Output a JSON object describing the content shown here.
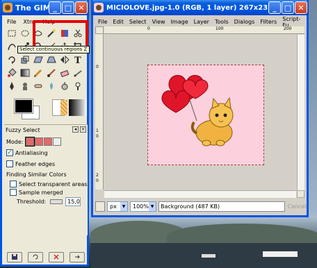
{
  "toolbox": {
    "title": "The GIMP",
    "menu": [
      "File",
      "Xtns",
      "Help"
    ],
    "tooltip": "Select continuous regions   Z",
    "tools": [
      "rect-select-icon",
      "ellipse-select-icon",
      "free-select-icon",
      "fuzzy-select-icon",
      "color-select-icon",
      "scissors-icon",
      "paths-icon",
      "color-picker-icon",
      "zoom-icon",
      "measure-icon",
      "move-icon",
      "crop-icon",
      "rotate-icon",
      "scale-icon",
      "shear-icon",
      "perspective-icon",
      "flip-icon",
      "text-icon",
      "bucket-fill-icon",
      "blend-icon",
      "pencil-icon",
      "paintbrush-icon",
      "eraser-icon",
      "airbrush-icon",
      "ink-icon",
      "clone-icon",
      "heal-icon",
      "convolve-icon",
      "smudge-icon",
      "dodge-icon"
    ],
    "options": {
      "title": "Fuzzy Select",
      "mode_label": "Mode:",
      "antialiasing": "Antialiasing",
      "feather_edges": "Feather edges",
      "finding_similar": "Finding Similar Colors",
      "select_transparent": "Select transparent areas",
      "sample_merged": "Sample merged",
      "threshold_label": "Threshold:",
      "threshold_value": "15,0"
    }
  },
  "image_window": {
    "title": "MICIOLOVE.jpg-1.0 (RGB, 1 layer) 267x231",
    "menu": [
      "File",
      "Edit",
      "Select",
      "View",
      "Image",
      "Layer",
      "Tools",
      "Dialogs",
      "Filters",
      "Script-Fu"
    ],
    "ruler_top": [
      "0",
      "100",
      "200"
    ],
    "ruler_left": [
      "0",
      "1",
      "0",
      "2",
      "0"
    ],
    "unit": "px",
    "zoom": "100%",
    "status": "Background (487 KB)",
    "cancel": "Cancel"
  }
}
